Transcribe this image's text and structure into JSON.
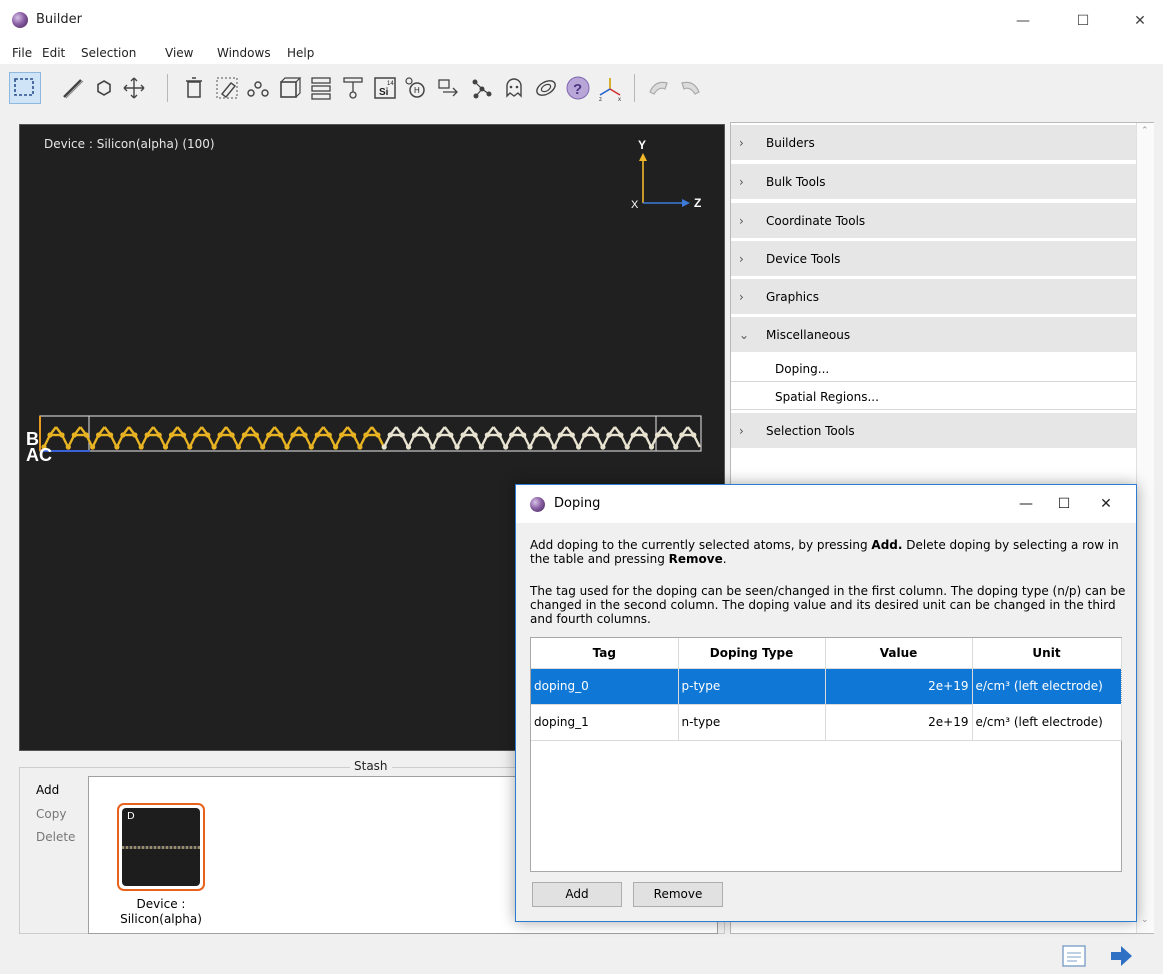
{
  "window": {
    "title": "Builder"
  },
  "menu": [
    "File",
    "Edit",
    "Selection",
    "View",
    "Windows",
    "Help"
  ],
  "viewport": {
    "label": "Device : Silicon(alpha) (100)",
    "axes": {
      "y": "Y",
      "z": "Z",
      "x": "X"
    },
    "cell_labels": "B\nA C"
  },
  "tools": {
    "sections": [
      "Builders",
      "Bulk Tools",
      "Coordinate Tools",
      "Device Tools",
      "Graphics",
      "Miscellaneous"
    ],
    "miscellaneous_items": [
      "Doping...",
      "Spatial Regions..."
    ],
    "after": "Selection Tools"
  },
  "stash": {
    "title": "Stash",
    "actions": [
      "Add",
      "Copy",
      "Delete"
    ],
    "item": {
      "badge": "D",
      "caption": "Device :\nSilicon(alpha)"
    }
  },
  "dialog": {
    "title": "Doping",
    "para1_a": "Add doping to the currently selected atoms, by pressing ",
    "para1_b": "Add.",
    "para1_c": " Delete doping by selecting a row in the table and pressing ",
    "para1_d": "Remove",
    "para1_e": ".",
    "para2": "The tag used for the doping can be seen/changed in the first column. The doping type (n/p) can be changed in the second column. The doping value and its desired unit can be changed in the third and fourth columns.",
    "columns": [
      "Tag",
      "Doping Type",
      "Value",
      "Unit"
    ],
    "rows": [
      {
        "tag": "doping_0",
        "type": "p-type",
        "value": "2e+19",
        "unit": "e/cm³ (left electrode)"
      },
      {
        "tag": "doping_1",
        "type": "n-type",
        "value": "2e+19",
        "unit": "e/cm³ (left electrode)"
      }
    ],
    "add_label": "Add",
    "remove_label": "Remove"
  },
  "colors": {
    "accent": "#0f77d6",
    "stash_highlight": "#e9621d",
    "atom_si_doped": "#e8b323",
    "atom_si": "#e8e2d0"
  }
}
